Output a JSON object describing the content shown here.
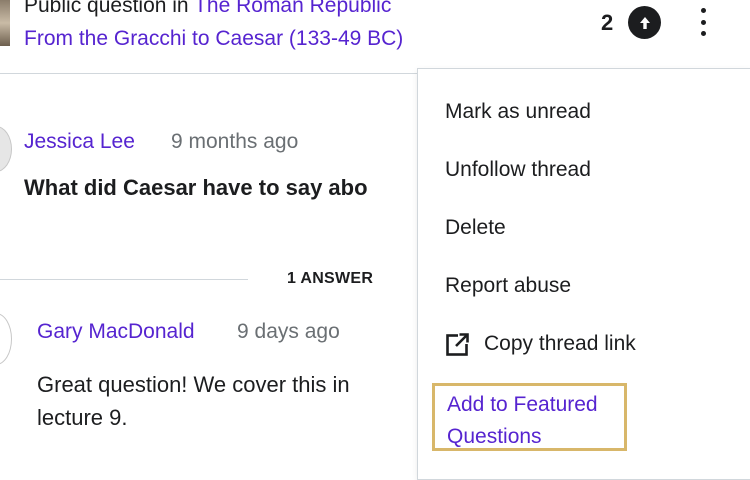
{
  "header": {
    "prefix": "Public question in",
    "course_link": "The Roman Republic",
    "section_link": "From the Gracchi to Caesar (133-49 BC)",
    "vote_count": "2",
    "upvote_icon": "arrow-up-icon",
    "more_icon": "kebab-icon"
  },
  "question": {
    "author": "Jessica Lee",
    "time": "9 months ago",
    "title": "What did Caesar have to say abo"
  },
  "answers_label": "1 ANSWER",
  "answer": {
    "author": "Gary MacDonald",
    "time": "9 days ago",
    "body": "Great question! We cover this in lecture 9."
  },
  "menu": {
    "items": [
      {
        "label": "Mark as unread"
      },
      {
        "label": "Unfollow thread"
      },
      {
        "label": "Delete"
      },
      {
        "label": "Report abuse"
      },
      {
        "label": "Copy thread link",
        "icon": "external-link-icon"
      }
    ],
    "featured": "Add to Featured Questions"
  },
  "colors": {
    "link": "#5624d0",
    "text": "#1c1d1f",
    "muted": "#6a6f73",
    "highlight_border": "#d8b76a"
  }
}
